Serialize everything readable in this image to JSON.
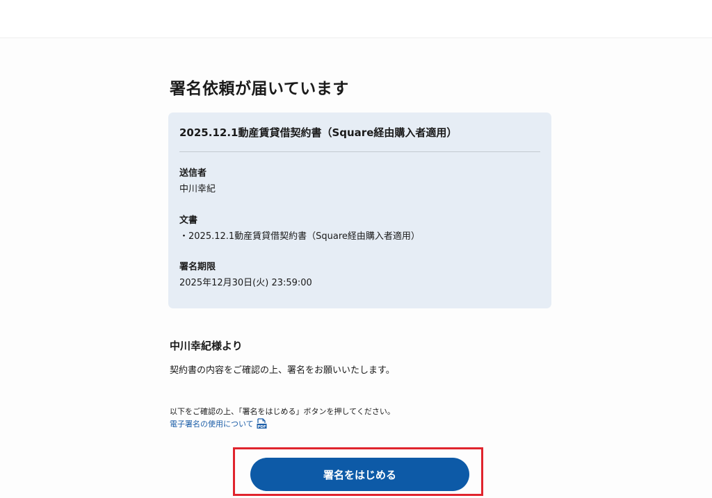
{
  "page": {
    "title": "署名依頼が届いています"
  },
  "document_card": {
    "title": "2025.12.1動産賃貸借契約書（Square経由購入者適用）",
    "sender_label": "送信者",
    "sender_value": "中川幸紀",
    "documents_label": "文書",
    "documents_value": "・2025.12.1動産賃貸借契約書（Square経由購入者適用）",
    "deadline_label": "署名期限",
    "deadline_value": "2025年12月30日(火) 23:59:00"
  },
  "message": {
    "heading": "中川幸紀様より",
    "body": "契約書の内容をご確認の上、署名をお願いいたします。"
  },
  "instructions": {
    "text": "以下をご確認の上、「署名をはじめる」ボタンを押してください。",
    "link_label": "電子署名の使用について",
    "link_icon": "pdf-icon"
  },
  "actions": {
    "start_label": "署名をはじめる"
  },
  "colors": {
    "card_bg": "#e6edf5",
    "button_bg": "#0d5aa7",
    "link": "#1c5ea8",
    "highlight": "#e0242d"
  }
}
